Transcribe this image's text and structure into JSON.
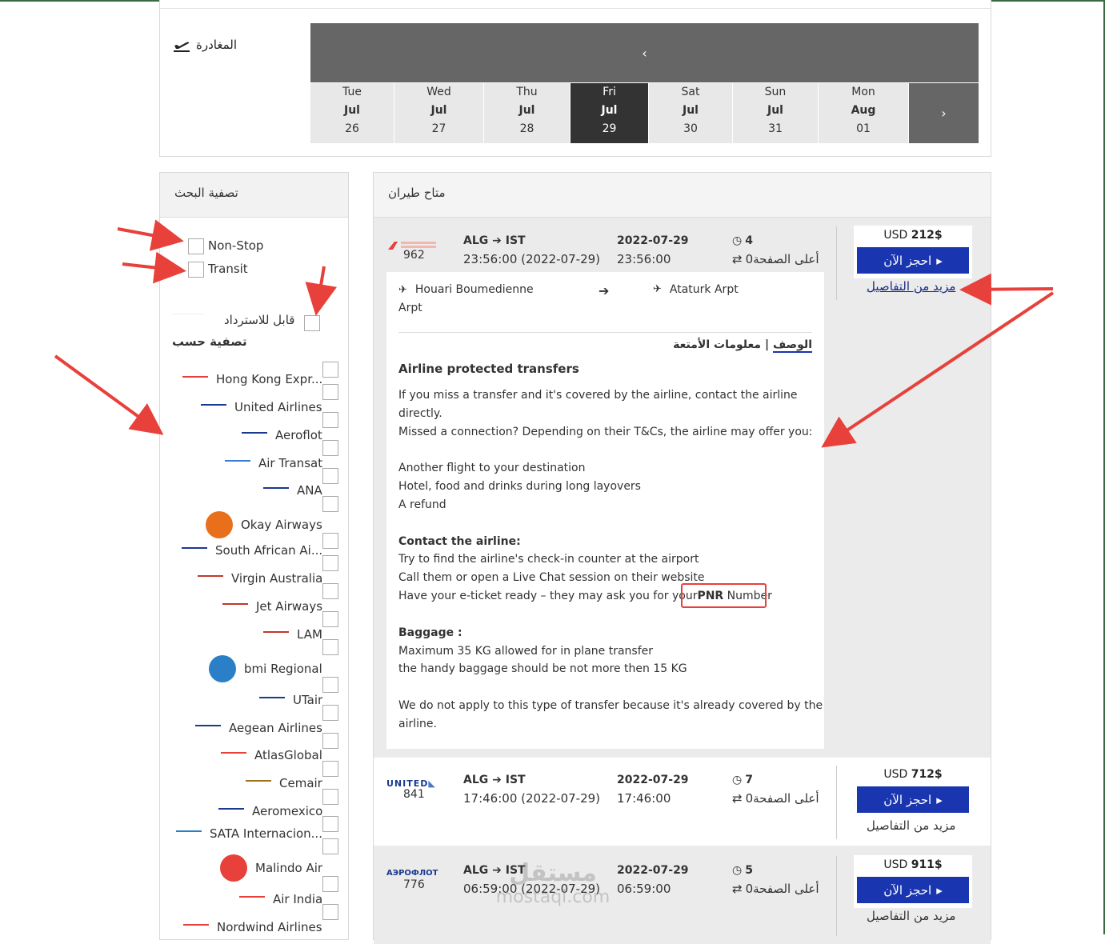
{
  "departure": {
    "label": "المغادرة",
    "icon": "plane-takeoff-icon"
  },
  "calendar": {
    "prev": "‹",
    "next": "›",
    "days": [
      {
        "dow": "Tue",
        "month": "Jul",
        "date": "26",
        "selected": false
      },
      {
        "dow": "Wed",
        "month": "Jul",
        "date": "27",
        "selected": false
      },
      {
        "dow": "Thu",
        "month": "Jul",
        "date": "28",
        "selected": false
      },
      {
        "dow": "Fri",
        "month": "Jul",
        "date": "29",
        "selected": true
      },
      {
        "dow": "Sat",
        "month": "Jul",
        "date": "30",
        "selected": false
      },
      {
        "dow": "Sun",
        "month": "Jul",
        "date": "31",
        "selected": false
      },
      {
        "dow": "Mon",
        "month": "Aug",
        "date": "01",
        "selected": false
      }
    ]
  },
  "filter": {
    "title": "تصفية البحث",
    "nonstop": "Non-Stop",
    "transit": "Transit",
    "refundable": "قابل للاسترداد",
    "filter_by": "تصفية حسب",
    "airlines": [
      "Hong Kong Expr...",
      "United Airlines",
      "Aeroflot",
      "Air Transat",
      "ANA",
      "Okay Airways",
      "South African Ai...",
      "Virgin Australia",
      "Jet Airways",
      "LAM",
      "bmi Regional",
      "UTair",
      "Aegean Airlines",
      "AtlasGlobal",
      "Cemair",
      "Aeromexico",
      "SATA Internacion...",
      "Malindo Air",
      "Air India",
      "Nordwind Airlines"
    ]
  },
  "results": {
    "title": "متاح طيران",
    "flights": [
      {
        "number": "962",
        "route_from": "ALG",
        "route_to": "IST",
        "datetime": "23:56:00 (2022-07-29)",
        "date": "2022-07-29",
        "time": "23:56:00",
        "stops": "4",
        "page": "أعلى الصفحة0",
        "price_prefix": "USD ",
        "price": "212$",
        "book": "احجز الآن",
        "details": "مزيد من التفاصيل"
      },
      {
        "number": "841",
        "route_from": "ALG",
        "route_to": "IST",
        "datetime": "17:46:00 (2022-07-29)",
        "date": "2022-07-29",
        "time": "17:46:00",
        "stops": "7",
        "page": "أعلى الصفحة0",
        "price_prefix": "USD ",
        "price": "712$",
        "book": "احجز الآن",
        "details": "مزيد من التفاصيل"
      },
      {
        "number": "776",
        "route_from": "ALG",
        "route_to": "IST",
        "datetime": "06:59:00 (2022-07-29)",
        "date": "2022-07-29",
        "time": "06:59:00",
        "stops": "5",
        "page": "أعلى الصفحة0",
        "price_prefix": "USD ",
        "price": "911$",
        "book": "احجز الآن",
        "details": "مزيد من التفاصيل"
      }
    ],
    "detail": {
      "from_airport": "Houari Boumedienne",
      "from_airport_2": "Arpt",
      "to_airport": "Ataturk Arpt",
      "tab_description": "الوصف",
      "tab_sep": " | ",
      "tab_baggage": "معلومات الأمتعة",
      "heading": "Airline protected transfers",
      "lines": [
        "If you miss a transfer and it's covered by the airline, contact the airline",
        "directly.",
        "Missed a connection? Depending on their T&Cs, the airline may offer you:",
        "Another flight to your destination",
        "Hotel, food and drinks during long layovers",
        "A refund"
      ],
      "contact_heading": "Contact the airline:",
      "contact_lines": [
        "Try to find the airline's check-in counter at the airport",
        "Call them or open a Live Chat session on their website",
        "Have your e-ticket ready – they may ask you for your"
      ],
      "pnr_bold": "PNR",
      "pnr_rest": " Number",
      "baggage_heading": "Baggage :",
      "baggage_lines": [
        "Maximum 35 KG allowed for in plane transfer",
        "the handy baggage should be not more then 15 KG"
      ],
      "footer_lines": [
        "We do not apply to this type of transfer because it's already covered by the",
        "airline."
      ]
    }
  },
  "watermark": {
    "arabic": "مستقل",
    "latin": "mostaql.com"
  },
  "colors": {
    "accent_blue": "#1a35b0",
    "annotation_red": "#e8403a",
    "calendar_dark": "#333333",
    "calendar_gray": "#666666"
  }
}
